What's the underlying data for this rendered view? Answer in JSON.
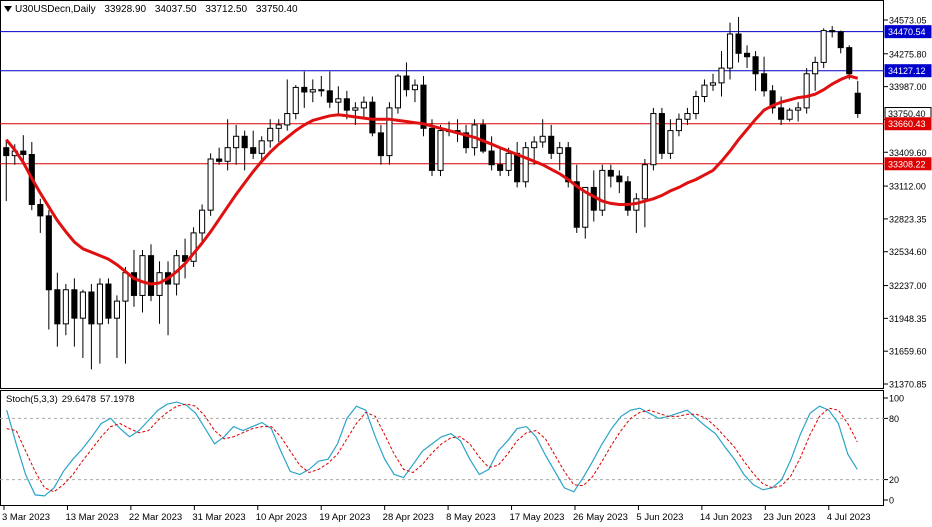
{
  "header": {
    "symbol_tf": "U30USDecn,Daily",
    "open": "33928.90",
    "high": "34037.50",
    "low": "33712.50",
    "close": "33750.40"
  },
  "stoch": {
    "label": "Stoch(5,3,3)",
    "main_value": "29.6478",
    "signal_value": "57.1978",
    "levels": [
      "100",
      "80",
      "20",
      "0"
    ]
  },
  "price_axis": {
    "ticks": [
      "34573.05",
      "34275.80",
      "33987.00",
      "33698.25",
      "33409.60",
      "33112.00",
      "32823.35",
      "32534.60",
      "32237.00",
      "31948.35",
      "31659.60",
      "31370.85"
    ]
  },
  "price_labels": [
    {
      "text": "34470.54",
      "bg": "#0000cc",
      "fg": "#ffffff",
      "value": 34470.54
    },
    {
      "text": "34127.12",
      "bg": "#0000cc",
      "fg": "#ffffff",
      "value": 34127.12
    },
    {
      "text": "33750.40",
      "bg": "#ffffff",
      "fg": "#000000",
      "value": 33750.4
    },
    {
      "text": "33660.43",
      "bg": "#dd0000",
      "fg": "#ffffff",
      "value": 33660.43
    },
    {
      "text": "33308.22",
      "bg": "#dd0000",
      "fg": "#ffffff",
      "value": 33308.22
    }
  ],
  "time_axis": [
    "3 Mar 2023",
    "13 Mar 2023",
    "22 Mar 2023",
    "31 Mar 2023",
    "10 Apr 2023",
    "19 Apr 2023",
    "28 Apr 2023",
    "8 May 2023",
    "17 May 2023",
    "26 May 2023",
    "5 Jun 2023",
    "14 Jun 2023",
    "23 Jun 2023",
    "4 Jul 2023"
  ],
  "colors": {
    "blue_line": "#0000cc",
    "red_line": "#dd0000",
    "ma": "#e01010",
    "stoch_main": "#2aa4c8",
    "stoch_signal": "#dd0000",
    "candle": "#000000"
  },
  "chart_data": {
    "type": "candlestick",
    "horizontal_lines": [
      34470.54,
      34127.12,
      33660.43,
      33308.22
    ],
    "ylim": [
      31370.85,
      34573.05
    ],
    "candles": [
      [
        33450,
        33520,
        32980,
        33380
      ],
      [
        33380,
        33480,
        33300,
        33420
      ],
      [
        33420,
        33560,
        33300,
        33390
      ],
      [
        33390,
        33500,
        32900,
        32950
      ],
      [
        32950,
        33000,
        32700,
        32850
      ],
      [
        32850,
        32900,
        31850,
        32200
      ],
      [
        32200,
        32350,
        31700,
        31900
      ],
      [
        31900,
        32250,
        31800,
        32200
      ],
      [
        32200,
        32300,
        31700,
        31950
      ],
      [
        31950,
        32200,
        31600,
        32180
      ],
      [
        32180,
        32250,
        31500,
        31900
      ],
      [
        31900,
        32300,
        31550,
        32250
      ],
      [
        32250,
        32300,
        31900,
        31950
      ],
      [
        31950,
        32150,
        31600,
        32100
      ],
      [
        32100,
        32400,
        31550,
        32350
      ],
      [
        32350,
        32550,
        32050,
        32150
      ],
      [
        32150,
        32550,
        32000,
        32500
      ],
      [
        32500,
        32600,
        32100,
        32150
      ],
      [
        32150,
        32450,
        31900,
        32350
      ],
      [
        32350,
        32450,
        31800,
        32250
      ],
      [
        32250,
        32550,
        32150,
        32500
      ],
      [
        32500,
        32650,
        32300,
        32450
      ],
      [
        32450,
        32750,
        32400,
        32700
      ],
      [
        32700,
        32950,
        32600,
        32900
      ],
      [
        32900,
        33400,
        32850,
        33350
      ],
      [
        33350,
        33450,
        33300,
        33330
      ],
      [
        33330,
        33700,
        33250,
        33450
      ],
      [
        33450,
        33650,
        33300,
        33550
      ],
      [
        33550,
        33600,
        33250,
        33450
      ],
      [
        33450,
        33600,
        33350,
        33400
      ],
      [
        33400,
        33550,
        33320,
        33510
      ],
      [
        33510,
        33700,
        33450,
        33620
      ],
      [
        33620,
        33700,
        33500,
        33650
      ],
      [
        33650,
        34050,
        33600,
        33750
      ],
      [
        33750,
        34000,
        33700,
        33980
      ],
      [
        33980,
        34120,
        33800,
        33940
      ],
      [
        33940,
        34050,
        33850,
        33960
      ],
      [
        33960,
        34080,
        33900,
        33950
      ],
      [
        33950,
        34120,
        33800,
        33850
      ],
      [
        33850,
        33990,
        33750,
        33880
      ],
      [
        33880,
        33950,
        33700,
        33780
      ],
      [
        33780,
        33850,
        33650,
        33800
      ],
      [
        33800,
        33900,
        33700,
        33850
      ],
      [
        33850,
        33900,
        33550,
        33580
      ],
      [
        33580,
        33650,
        33300,
        33380
      ],
      [
        33380,
        33850,
        33300,
        33800
      ],
      [
        33800,
        34100,
        33750,
        34080
      ],
      [
        34080,
        34200,
        33900,
        33960
      ],
      [
        33960,
        34050,
        33850,
        34000
      ],
      [
        34000,
        34080,
        33550,
        33620
      ],
      [
        33620,
        33700,
        33200,
        33250
      ],
      [
        33250,
        33650,
        33200,
        33600
      ],
      [
        33600,
        33680,
        33550,
        33600
      ],
      [
        33600,
        33700,
        33500,
        33580
      ],
      [
        33580,
        33650,
        33400,
        33450
      ],
      [
        33450,
        33700,
        33380,
        33650
      ],
      [
        33650,
        33700,
        33400,
        33420
      ],
      [
        33420,
        33550,
        33250,
        33300
      ],
      [
        33300,
        33450,
        33200,
        33250
      ],
      [
        33250,
        33450,
        33200,
        33400
      ],
      [
        33400,
        33500,
        33100,
        33150
      ],
      [
        33150,
        33500,
        33100,
        33450
      ],
      [
        33450,
        33550,
        33300,
        33500
      ],
      [
        33500,
        33700,
        33450,
        33550
      ],
      [
        33550,
        33650,
        33350,
        33400
      ],
      [
        33400,
        33500,
        33250,
        33450
      ],
      [
        33450,
        33500,
        33100,
        33150
      ],
      [
        33150,
        33300,
        32700,
        32750
      ],
      [
        32750,
        33100,
        32650,
        33100
      ],
      [
        33100,
        33250,
        32800,
        32900
      ],
      [
        32900,
        33300,
        32850,
        33250
      ],
      [
        33250,
        33300,
        33100,
        33200
      ],
      [
        33200,
        33250,
        33050,
        33150
      ],
      [
        33150,
        33200,
        32850,
        32900
      ],
      [
        32900,
        33050,
        32700,
        33000
      ],
      [
        33000,
        33350,
        32750,
        33300
      ],
      [
        33300,
        33800,
        33250,
        33750
      ],
      [
        33750,
        33800,
        33350,
        33400
      ],
      [
        33400,
        33700,
        33350,
        33600
      ],
      [
        33600,
        33750,
        33550,
        33700
      ],
      [
        33700,
        33800,
        33650,
        33750
      ],
      [
        33750,
        33950,
        33700,
        33900
      ],
      [
        33900,
        34050,
        33850,
        34000
      ],
      [
        34000,
        34100,
        33950,
        34020
      ],
      [
        34020,
        34300,
        33900,
        34150
      ],
      [
        34150,
        34550,
        34050,
        34450
      ],
      [
        34450,
        34600,
        34200,
        34280
      ],
      [
        34280,
        34350,
        34150,
        34250
      ],
      [
        34250,
        34300,
        33950,
        34100
      ],
      [
        34100,
        34250,
        33900,
        33950
      ],
      [
        33950,
        34000,
        33750,
        33800
      ],
      [
        33800,
        33900,
        33650,
        33700
      ],
      [
        33700,
        33800,
        33680,
        33780
      ],
      [
        33780,
        33850,
        33680,
        33800
      ],
      [
        33800,
        34150,
        33750,
        34100
      ],
      [
        34100,
        34250,
        33950,
        34200
      ],
      [
        34200,
        34500,
        34150,
        34480
      ],
      [
        34480,
        34520,
        34420,
        34470
      ],
      [
        34470,
        34480,
        34280,
        34330
      ],
      [
        34330,
        34350,
        34050,
        34100
      ],
      [
        33928.9,
        34037.5,
        33712.5,
        33750.4
      ]
    ],
    "ma": [
      33520,
      33430,
      33320,
      33180,
      33050,
      32930,
      32810,
      32710,
      32620,
      32560,
      32530,
      32500,
      32470,
      32420,
      32360,
      32300,
      32270,
      32250,
      32260,
      32300,
      32360,
      32430,
      32520,
      32610,
      32710,
      32820,
      32930,
      33040,
      33140,
      33240,
      33330,
      33410,
      33480,
      33540,
      33600,
      33650,
      33690,
      33710,
      33730,
      33740,
      33730,
      33720,
      33710,
      33700,
      33700,
      33700,
      33690,
      33680,
      33670,
      33660,
      33640,
      33620,
      33600,
      33580,
      33560,
      33540,
      33510,
      33480,
      33450,
      33420,
      33390,
      33360,
      33330,
      33300,
      33260,
      33220,
      33170,
      33110,
      33060,
      33020,
      32980,
      32960,
      32950,
      32950,
      32960,
      32980,
      33000,
      33030,
      33070,
      33100,
      33140,
      33170,
      33210,
      33250,
      33330,
      33420,
      33520,
      33610,
      33700,
      33780,
      33820,
      33850,
      33870,
      33890,
      33900,
      33920,
      33960,
      34010,
      34050,
      34080,
      34060
    ],
    "stoch_main": [
      88,
      55,
      25,
      5,
      4,
      12,
      28,
      40,
      50,
      62,
      75,
      80,
      70,
      62,
      68,
      78,
      88,
      94,
      96,
      93,
      85,
      70,
      55,
      62,
      72,
      68,
      72,
      76,
      70,
      48,
      28,
      25,
      30,
      38,
      40,
      55,
      80,
      92,
      88,
      62,
      40,
      25,
      22,
      35,
      48,
      55,
      62,
      65,
      58,
      40,
      25,
      30,
      48,
      58,
      70,
      72,
      62,
      44,
      28,
      12,
      8,
      22,
      38,
      55,
      70,
      82,
      88,
      90,
      85,
      80,
      82,
      85,
      88,
      80,
      72,
      65,
      52,
      40,
      25,
      15,
      10,
      12,
      20,
      40,
      65,
      85,
      92,
      88,
      75,
      45,
      30
    ],
    "stoch_signal": [
      70,
      68,
      48,
      28,
      12,
      8,
      15,
      25,
      38,
      50,
      62,
      72,
      75,
      70,
      66,
      68,
      78,
      86,
      92,
      94,
      92,
      82,
      68,
      60,
      62,
      66,
      70,
      72,
      72,
      62,
      48,
      34,
      27,
      30,
      36,
      45,
      60,
      75,
      86,
      82,
      64,
      45,
      30,
      27,
      35,
      46,
      55,
      61,
      62,
      55,
      42,
      32,
      34,
      45,
      58,
      66,
      68,
      60,
      44,
      28,
      15,
      14,
      23,
      38,
      54,
      68,
      80,
      86,
      88,
      85,
      82,
      82,
      84,
      84,
      80,
      72,
      62,
      52,
      38,
      26,
      16,
      12,
      14,
      24,
      42,
      64,
      82,
      90,
      88,
      75,
      57
    ]
  }
}
